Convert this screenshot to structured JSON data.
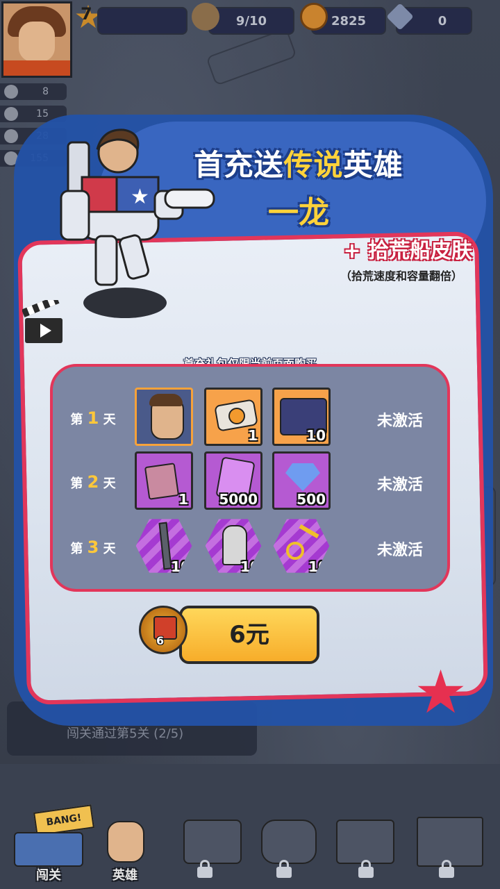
{
  "hud": {
    "level": "7",
    "energy": "9/10",
    "coins": "2825",
    "gems": "0",
    "side_stats": [
      "8",
      "15",
      "28",
      "155"
    ]
  },
  "popup": {
    "title_prefix": "首充送",
    "title_highlight": "传说",
    "title_suffix": "英雄",
    "hero_name": "一龙",
    "bonus": "+ 拾荒船皮肤",
    "bonus_note": "（拾荒速度和容量翻倍）",
    "notice": "首充礼包仅限当前页面购买",
    "days": [
      {
        "prefix": "第",
        "num": "1",
        "suffix": "天",
        "status": "未激活",
        "items": [
          {
            "icon": "hero-portrait-icon",
            "count": ""
          },
          {
            "icon": "scavenger-ship-icon",
            "count": "1"
          },
          {
            "icon": "roth-banner-icon",
            "count": "10"
          }
        ]
      },
      {
        "prefix": "第",
        "num": "2",
        "suffix": "天",
        "status": "未激活",
        "items": [
          {
            "icon": "crate-pack-icon",
            "count": "1"
          },
          {
            "icon": "exp-card-icon",
            "count": "5000"
          },
          {
            "icon": "diamond-icon",
            "count": "500"
          }
        ]
      },
      {
        "prefix": "第",
        "num": "3",
        "suffix": "天",
        "status": "未激活",
        "items": [
          {
            "icon": "rifle-icon",
            "count": "10"
          },
          {
            "icon": "statue-icon",
            "count": "10"
          },
          {
            "icon": "exercise-bike-icon",
            "count": "10"
          }
        ]
      }
    ],
    "vip_level": "6",
    "price": "6元"
  },
  "mission": {
    "text": "闯关通过第5关 (2/5)"
  },
  "nav": {
    "items": [
      "闯关",
      "英雄"
    ],
    "banner": "BANG!"
  },
  "colors": {
    "accent_red": "#e2365a",
    "title_yellow": "#ffd23a",
    "popup_blue": "#2352a8",
    "button_yellow": "#f7ad2a"
  }
}
